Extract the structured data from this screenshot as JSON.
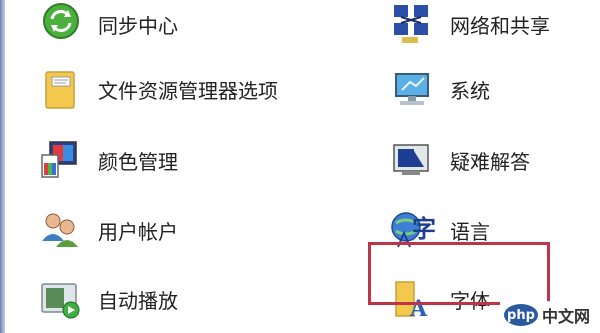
{
  "left_column": [
    {
      "label": "同步中心",
      "icon": "sync-icon"
    },
    {
      "label": "文件资源管理器选项",
      "icon": "folder-options-icon"
    },
    {
      "label": "颜色管理",
      "icon": "color-management-icon"
    },
    {
      "label": "用户帐户",
      "icon": "user-accounts-icon"
    },
    {
      "label": "自动播放",
      "icon": "autoplay-icon"
    }
  ],
  "right_column": [
    {
      "label": "网络和共享",
      "icon": "network-sharing-icon"
    },
    {
      "label": "系统",
      "icon": "system-icon"
    },
    {
      "label": "疑难解答",
      "icon": "troubleshooting-icon"
    },
    {
      "label": "语言",
      "icon": "language-icon"
    },
    {
      "label": "字体",
      "icon": "fonts-icon"
    }
  ],
  "watermark": {
    "badge": "php",
    "site": "中文网"
  },
  "colors": {
    "highlight": "#c0344a",
    "sync_green": "#4caf3e",
    "folder_yellow": "#f2c94c"
  }
}
